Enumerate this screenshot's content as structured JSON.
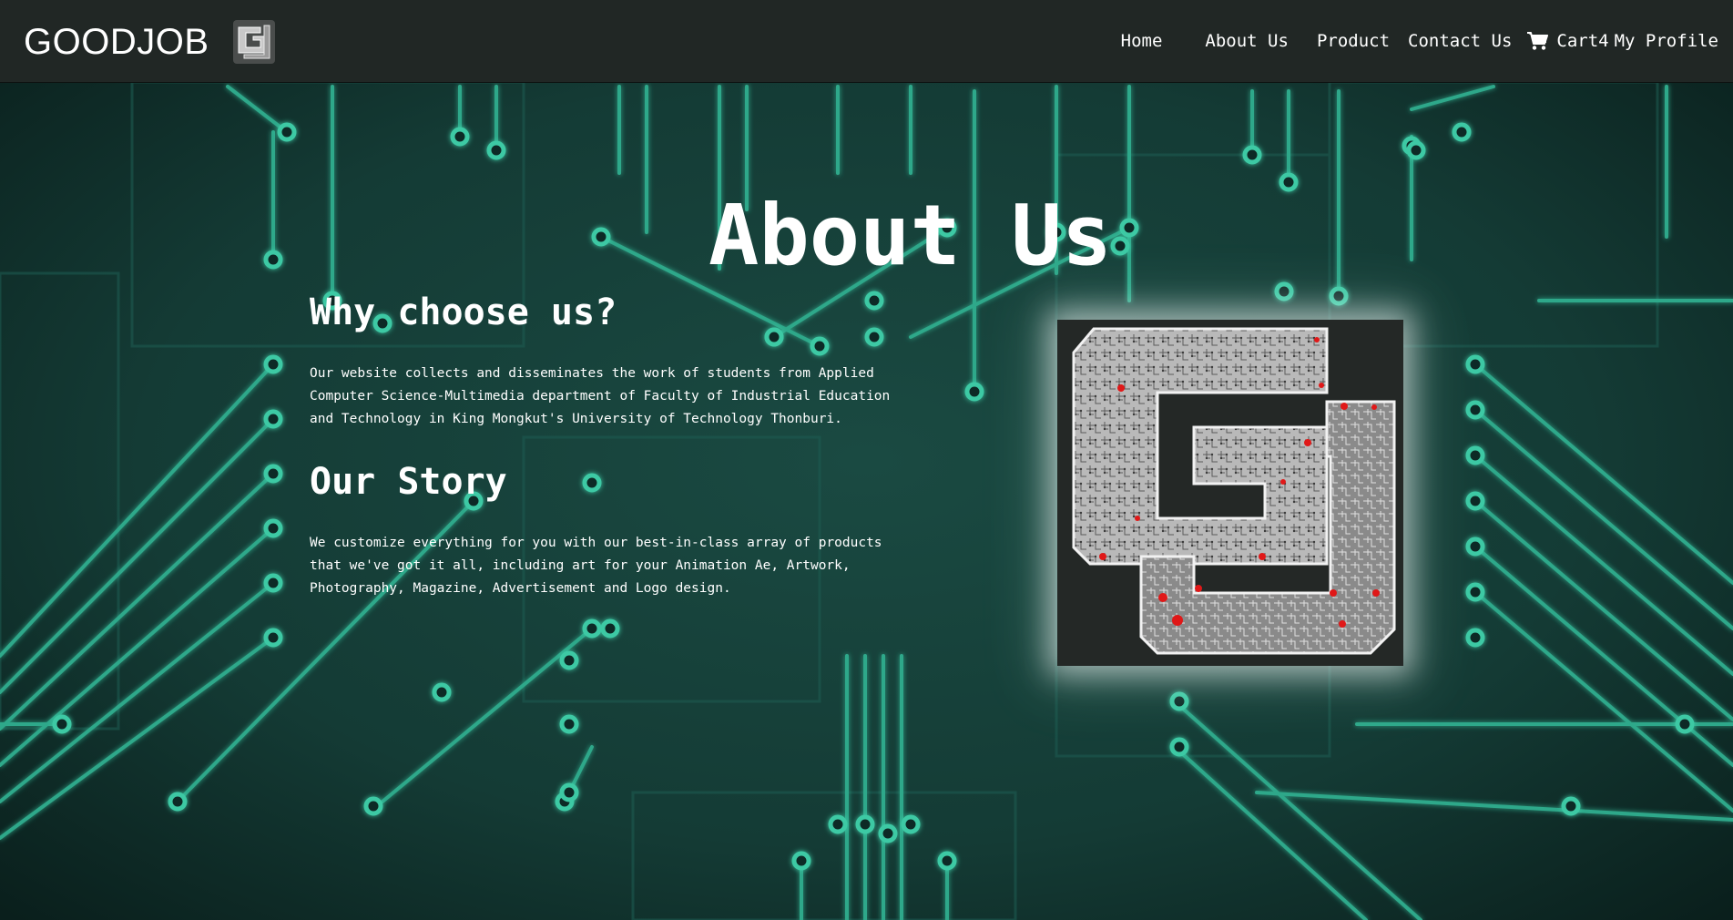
{
  "brand": {
    "name": "GOODJOB",
    "logo_icon": "gj-logo-icon"
  },
  "nav": {
    "home": "Home",
    "about": "About Us",
    "product": "Product",
    "contact": "Contact Us",
    "cart": "Cart4",
    "profile": "My Profile",
    "cart_icon": "shopping-cart-icon"
  },
  "page": {
    "title": "About Us",
    "why_heading": "Why choose us?",
    "why_text": "Our website collects and disseminates the work of students from Applied Computer Science-Multimedia department of Faculty of Industrial Education and Technology in King Mongkut's University of Technology Thonburi.",
    "story_heading": "Our Story",
    "story_text": "We customize everything for you with our best-in-class array of products that we've got it all, including art for your Animation Ae, Artwork, Photography, Magazine, Advertisement and Logo design."
  },
  "colors": {
    "navbar": "#212725",
    "background": "#0f2a26",
    "circuit": "#3cc9a4",
    "text": "#ffffff"
  }
}
